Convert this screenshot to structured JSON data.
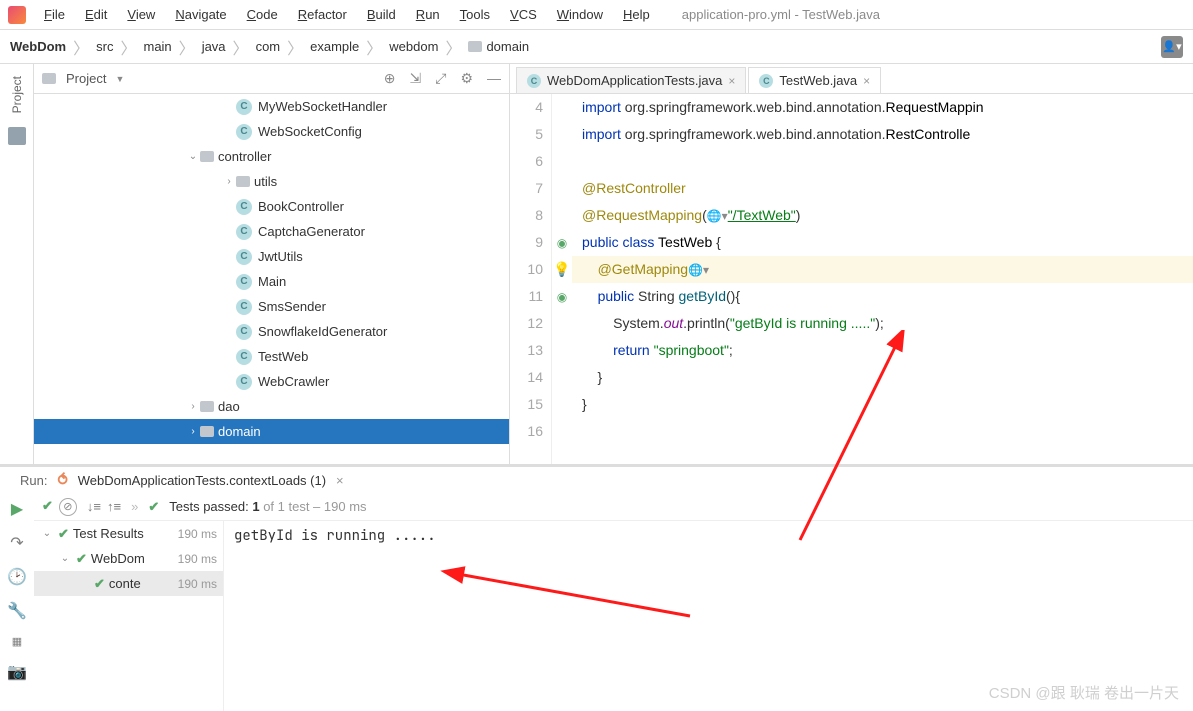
{
  "window": {
    "title": "application-pro.yml - TestWeb.java"
  },
  "menu": [
    "File",
    "Edit",
    "View",
    "Navigate",
    "Code",
    "Refactor",
    "Build",
    "Run",
    "Tools",
    "VCS",
    "Window",
    "Help"
  ],
  "breadcrumb": [
    "WebDom",
    "src",
    "main",
    "java",
    "com",
    "example",
    "webdom",
    "domain"
  ],
  "projectPanel": {
    "title": "Project"
  },
  "tree": [
    {
      "indent": 188,
      "chev": "",
      "icon": "class",
      "label": "MyWebSocketHandler"
    },
    {
      "indent": 188,
      "chev": "",
      "icon": "class",
      "label": "WebSocketConfig"
    },
    {
      "indent": 152,
      "chev": "v",
      "icon": "folder",
      "label": "controller"
    },
    {
      "indent": 188,
      "chev": ">",
      "icon": "folder",
      "label": "utils"
    },
    {
      "indent": 188,
      "chev": "",
      "icon": "class",
      "label": "BookController"
    },
    {
      "indent": 188,
      "chev": "",
      "icon": "class",
      "label": "CaptchaGenerator"
    },
    {
      "indent": 188,
      "chev": "",
      "icon": "class",
      "label": "JwtUtils"
    },
    {
      "indent": 188,
      "chev": "",
      "icon": "classrun",
      "label": "Main"
    },
    {
      "indent": 188,
      "chev": "",
      "icon": "class",
      "label": "SmsSender"
    },
    {
      "indent": 188,
      "chev": "",
      "icon": "class",
      "label": "SnowflakeIdGenerator"
    },
    {
      "indent": 188,
      "chev": "",
      "icon": "class",
      "label": "TestWeb"
    },
    {
      "indent": 188,
      "chev": "",
      "icon": "class",
      "label": "WebCrawler"
    },
    {
      "indent": 152,
      "chev": ">",
      "icon": "folder",
      "label": "dao"
    },
    {
      "indent": 152,
      "chev": ">",
      "icon": "folder",
      "label": "domain",
      "selected": true
    }
  ],
  "tabs": [
    {
      "label": "WebDomApplicationTests.java",
      "active": false
    },
    {
      "label": "TestWeb.java",
      "active": true
    }
  ],
  "code": {
    "start": 4,
    "lines": [
      {
        "n": 4,
        "mark": "",
        "hl": false,
        "html": "<span class='kw'>import</span> org.springframework.web.bind.annotation.<span class='cls'>RequestMappin</span>"
      },
      {
        "n": 5,
        "mark": "",
        "hl": false,
        "html": "<span class='kw'>import</span> org.springframework.web.bind.annotation.<span class='cls'>RestControlle</span>"
      },
      {
        "n": 6,
        "mark": "",
        "hl": false,
        "html": ""
      },
      {
        "n": 7,
        "mark": "",
        "hl": false,
        "html": "<span class='ann'>@RestController</span>"
      },
      {
        "n": 8,
        "mark": "",
        "hl": false,
        "html": "<span class='ann'>@RequestMapping</span>(<span class='globe'>🌐▾</span><span class='str str-u'>\"/TextWeb\"</span>)"
      },
      {
        "n": 9,
        "mark": "run",
        "hl": false,
        "html": "<span class='kw'>public</span> <span class='kw'>class</span> <span class='cls'>TestWeb</span> {"
      },
      {
        "n": 10,
        "mark": "bulb",
        "hl": true,
        "html": "    <span class='ann'>@GetMapping</span><span class='globe'>🌐▾</span>"
      },
      {
        "n": 11,
        "mark": "run",
        "hl": false,
        "html": "    <span class='kw'>public</span> String <span class='mtd'>getById</span>(){"
      },
      {
        "n": 12,
        "mark": "",
        "hl": false,
        "html": "        System.<span class='fld'>out</span>.println(<span class='str'>\"getById is running .....\"</span>);"
      },
      {
        "n": 13,
        "mark": "",
        "hl": false,
        "html": "        <span class='kw'>return</span> <span class='str'>\"springboot\"</span>;"
      },
      {
        "n": 14,
        "mark": "",
        "hl": false,
        "html": "    }"
      },
      {
        "n": 15,
        "mark": "",
        "hl": false,
        "html": "}"
      },
      {
        "n": 16,
        "mark": "",
        "hl": false,
        "html": ""
      }
    ]
  },
  "run": {
    "label": "Run:",
    "config": "WebDomApplicationTests.contextLoads (1)",
    "passedPrefix": "Tests passed: ",
    "passedBold": "1",
    "passedSuffix": " of 1 test – 190 ms",
    "tests": [
      {
        "indent": 0,
        "chev": "v",
        "label": "Test Results",
        "ms": "190 ms",
        "sel": false
      },
      {
        "indent": 18,
        "chev": "v",
        "label": "WebDom",
        "ms": "190 ms",
        "sel": false
      },
      {
        "indent": 36,
        "chev": "",
        "label": "conte",
        "ms": "190 ms",
        "sel": true
      }
    ],
    "console": "getById is running ....."
  },
  "watermark": "CSDN @跟 耿瑞 卷出一片天"
}
